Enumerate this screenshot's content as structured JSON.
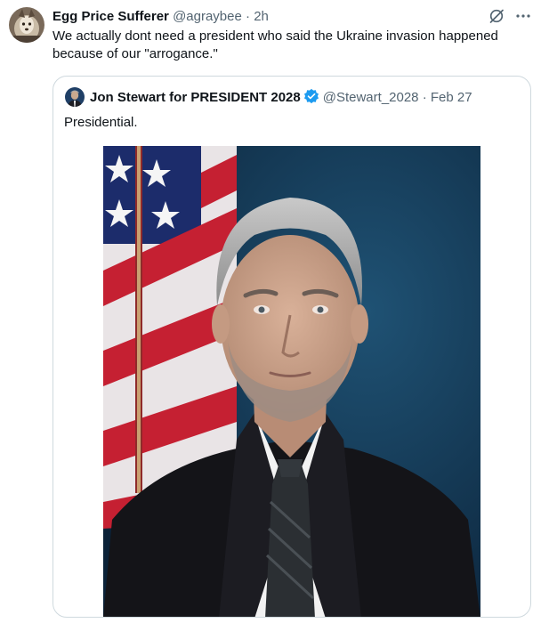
{
  "tweet": {
    "author_name": "Egg Price Sufferer",
    "handle": "@agraybee",
    "separator": "·",
    "time": "2h",
    "text": "We actually dont need a president who said the Ukraine invasion happened because of our \"arrogance.\""
  },
  "quoted_tweet": {
    "author_name": "Jon Stewart for PRESIDENT 2028",
    "handle": "@Stewart_2028",
    "separator": "·",
    "date": "Feb 27",
    "text": "Presidential."
  },
  "icons": {
    "grok": "grok-icon",
    "more": "more-icon",
    "verified": "verified-badge-icon"
  },
  "colors": {
    "text_primary": "#0f1419",
    "text_secondary": "#536471",
    "verified_blue": "#1d9bf0",
    "border": "#cfd9de"
  }
}
